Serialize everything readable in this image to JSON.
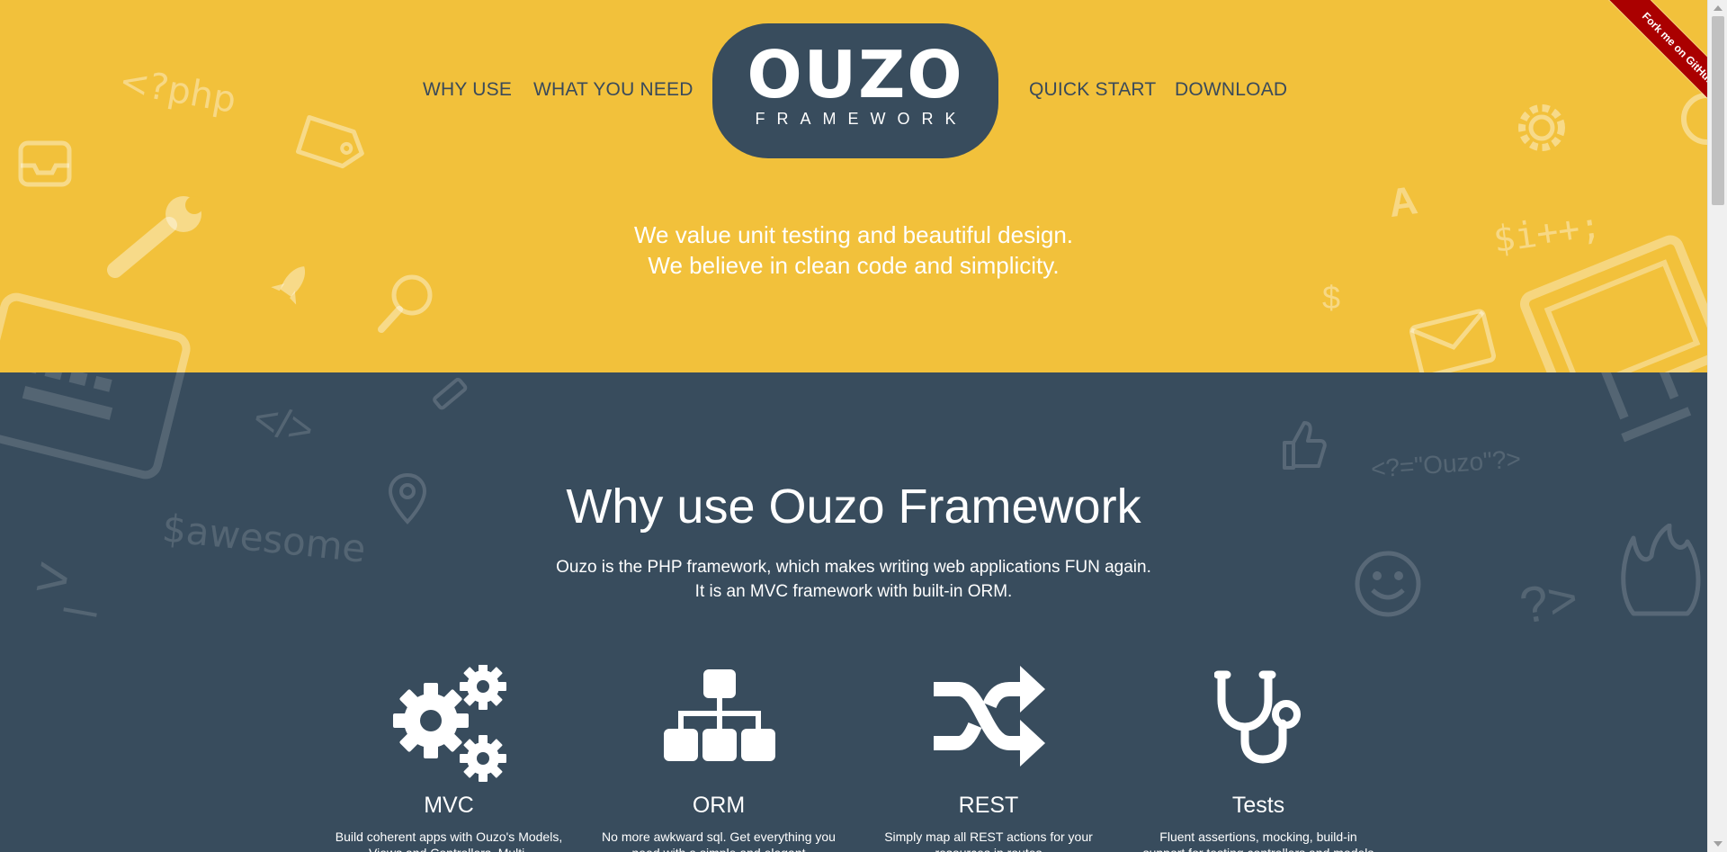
{
  "nav": {
    "why_use": "WHY USE",
    "what_you_need": "WHAT YOU NEED",
    "quick_start": "QUICK START",
    "download": "DOWNLOAD"
  },
  "logo": {
    "title": "OUZO",
    "subtitle": "FRAMEWORK"
  },
  "hero": {
    "tagline_line1": "We value unit testing and beautiful design.",
    "tagline_line2": "We believe in clean code and simplicity.",
    "decorations": {
      "php_tag": "<?php",
      "increment": "$i++;",
      "dollar": "$",
      "letter_a": "A"
    }
  },
  "why": {
    "title": "Why use Ouzo Framework",
    "desc_line1": "Ouzo is the PHP framework, which makes writing web applications FUN again.",
    "desc_line2": "It is an MVC framework with built-in ORM.",
    "decorations": {
      "awesome": "$awesome",
      "prompt": ">_",
      "ouzo_tag": "<?=\"Ouzo\"?>",
      "code_tag": "</>",
      "question": "?>"
    },
    "features": [
      {
        "icon": "gears-icon",
        "title": "MVC",
        "text": "Build coherent apps with Ouzo's Models, Views and Controllers. Multi-"
      },
      {
        "icon": "sitemap-icon",
        "title": "ORM",
        "text": "No more awkward sql. Get everything you need with a simple and elegant"
      },
      {
        "icon": "shuffle-icon",
        "title": "REST",
        "text": "Simply map all REST actions for your resources in routes"
      },
      {
        "icon": "stethoscope-icon",
        "title": "Tests",
        "text": "Fluent assertions, mocking, build-in support for testing controllers and models"
      }
    ]
  },
  "ribbon": {
    "label": "Fork me on GitHub"
  },
  "colors": {
    "hero_bg": "#f2c13b",
    "dark_bg": "#384c5d",
    "nav_text": "#3a4a5a",
    "ribbon": "#aa0000"
  }
}
